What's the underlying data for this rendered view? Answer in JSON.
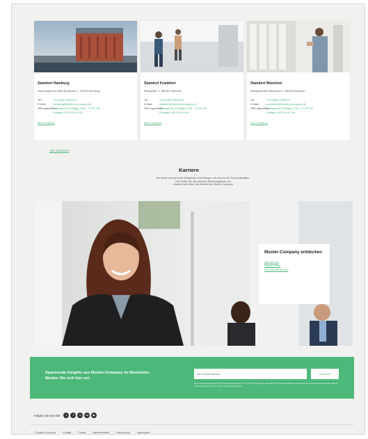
{
  "locations": [
    {
      "title": "Standort Hamburg",
      "address": "Hamburgischer Welt-Boulevard 1, 20000 Hamburg",
      "tel_label": "Tel.:",
      "tel_value": "+49 (0)40 000000-0",
      "email_label": "E-Mail:",
      "email_value": "hamburg@muster-company.de",
      "hours_label": "Öffnungszeiten:",
      "hours_value": "Montags bis Freitags, 9:00 - 17:00 Uhr",
      "hours_value2": "Freitags 9:00-16:00 Uhr",
      "link": "Mehr erfahren"
    },
    {
      "title": "Standort Frankfurt",
      "address": "Beispielstr. 1, 60000 Frankfurt",
      "tel_label": "Tel.:",
      "tel_value": "+49 (0)69 000000-0",
      "email_label": "E-Mail:",
      "email_value": "frankfurt@muster-company.de",
      "hours_label": "Öffnungszeiten:",
      "hours_value": "Montags bis Freitags, 9:00 - 17:00 Uhr",
      "hours_value2": "Freitags 9:00-16:00 Uhr",
      "link": "Mehr erfahren"
    },
    {
      "title": "Standort München",
      "address": "Beispielstraße Boulevard 1, 80000 München",
      "tel_label": "Tel.:",
      "tel_value": "+49 (0)89 000000-0",
      "email_label": "E-Mail:",
      "email_value": "muenchen@muster-company.de",
      "hours_label": "Öffnungszeiten:",
      "hours_value": "Montags bis Freitags, 9:00 - 17:00 Uhr",
      "hours_value2": "Freitags 9:00-16:00 Uhr",
      "link": "Mehr erfahren"
    }
  ],
  "all_locations_link": "Alle Standorte",
  "careers": {
    "title": "Karriere",
    "text_1": "Wir freuen uns auf neue Kolleginnen und Kollegen, die mit uns die Zukunft gestalten.",
    "text_2": "Hier finden Sie alle aktuellen Stellenangebote und",
    "text_3": "erfahren mehr über das Arbeiten bei Muster-Company."
  },
  "hero": {
    "panel_title": "Muster-Company entdecken",
    "links": [
      "Wer wir sind",
      "Unsere Werte",
      "Ihre Karriere bei uns"
    ]
  },
  "newsletter": {
    "title": "Spannende Insights aus Muster-Company im Newsletter. Melden Sie sich hier an!",
    "placeholder": "Ihre E-Mail-Adresse",
    "button": "Anmelden",
    "legal": "Mit der Anmeldung erklären Sie sich damit einverstanden, dass wir Ihnen regelmäßig Informationen per E-Mail zusenden. Sie können sich jederzeit wieder abmelden. Weitere Informationen finden Sie in unserer Datenschutzerklärung."
  },
  "social": {
    "label": "Folgen Sie uns bei",
    "icons": [
      "facebook-icon",
      "twitter-icon",
      "xing-icon",
      "linkedin-icon",
      "youtube-icon"
    ],
    "glyphs": [
      "f",
      "t",
      "x",
      "in",
      "▶"
    ]
  },
  "footer": {
    "copyright": "© Muster-Company",
    "links": [
      "Kontakt",
      "Presse",
      "Barrierefreiheit",
      "Datenschutz",
      "Impressum"
    ]
  },
  "colors": {
    "accent": "#4cb879",
    "link": "#47b57a",
    "background": "#f1f1ef"
  }
}
